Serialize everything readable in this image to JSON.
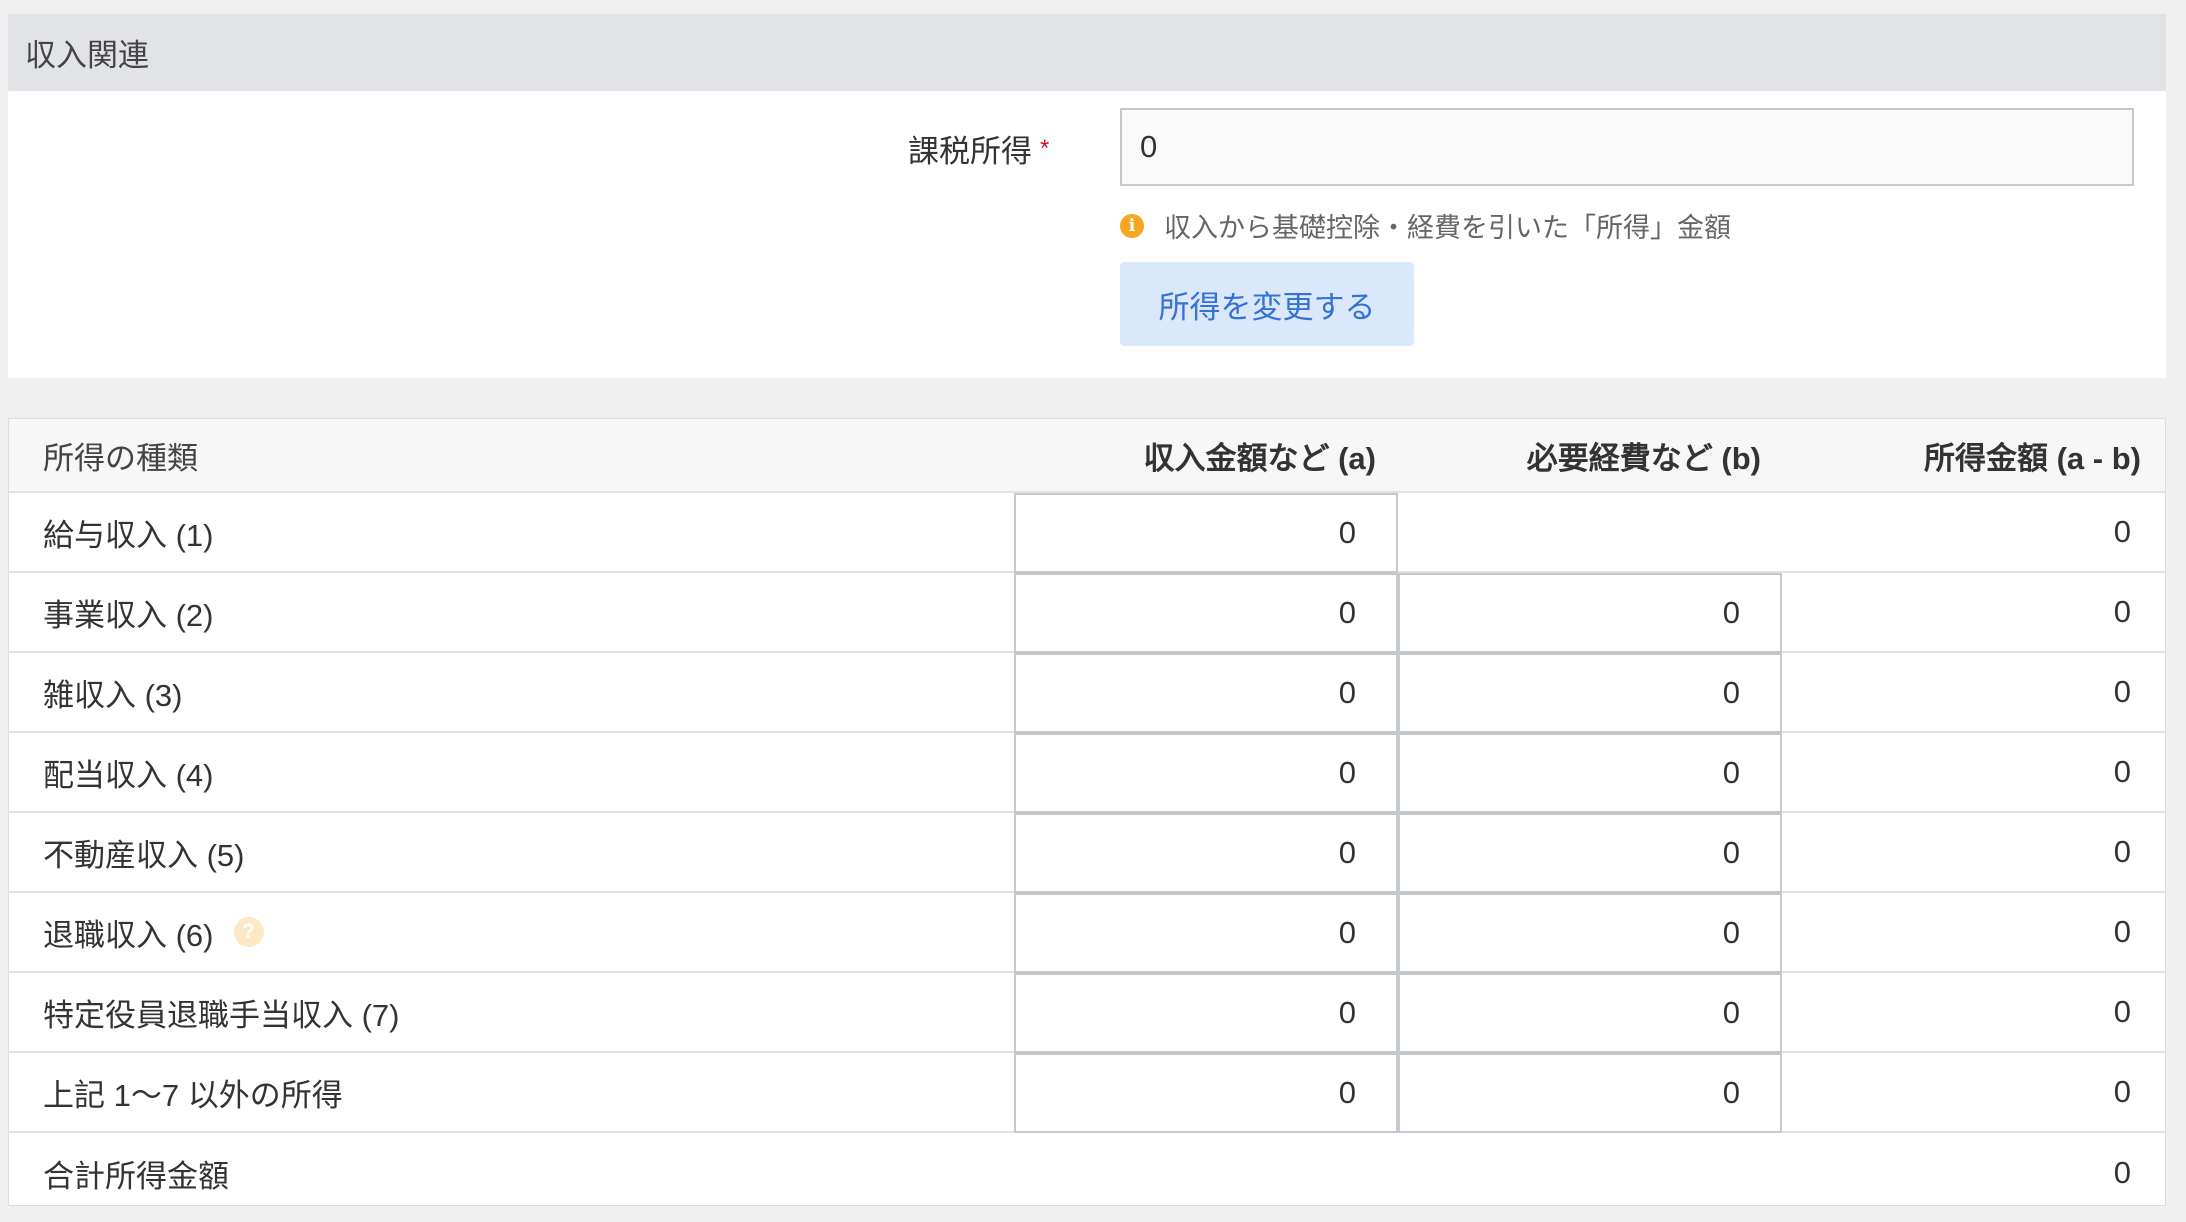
{
  "section": {
    "title": "収入関連"
  },
  "taxable_income": {
    "label": "課税所得",
    "required_mark": "*",
    "value": "0",
    "help_text": "収入から基礎控除・経費を引いた「所得」金額",
    "button_label": "所得を変更する"
  },
  "colors": {
    "accent": "#3572d8",
    "button_bg": "#dbe7fb",
    "required": "#d0112b",
    "info": "#f5a623"
  },
  "table": {
    "headers": {
      "type": "所得の種類",
      "income": "収入金額など (a)",
      "expenses": "必要経費など (b)",
      "result": "所得金額 (a - b)"
    },
    "rows": [
      {
        "label": "給与収入 (1)",
        "income": "0",
        "result": "0"
      },
      {
        "label": "事業収入 (2)",
        "income": "0",
        "expenses": "0",
        "result": "0"
      },
      {
        "label": "雑収入 (3)",
        "income": "0",
        "expenses": "0",
        "result": "0"
      },
      {
        "label": "配当収入 (4)",
        "income": "0",
        "expenses": "0",
        "result": "0"
      },
      {
        "label": "不動産収入 (5)",
        "income": "0",
        "expenses": "0",
        "result": "0"
      },
      {
        "label": "退職収入 (6)",
        "help_icon": "?",
        "income": "0",
        "expenses": "0",
        "result": "0"
      },
      {
        "label": "特定役員退職手当収入 (7)",
        "income": "0",
        "expenses": "0",
        "result": "0"
      },
      {
        "label": "上記 1〜7 以外の所得",
        "income": "0",
        "expenses": "0",
        "result": "0"
      }
    ],
    "total": {
      "label": "合計所得金額",
      "result": "0"
    }
  }
}
